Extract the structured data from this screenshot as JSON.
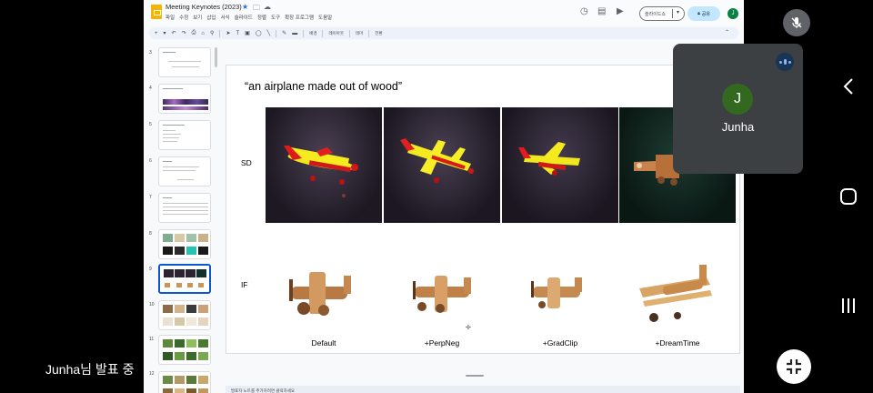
{
  "doc": {
    "title": "Meeting Keynotes (2023)",
    "menu": [
      "파일",
      "수정",
      "보기",
      "삽입",
      "서식",
      "슬라이드",
      "정렬",
      "도구",
      "확장 프로그램",
      "도움말"
    ],
    "slideshow_label": "슬라이드쇼",
    "share_label": "공유",
    "user_initial": "J"
  },
  "toolbar": {
    "background_label": "배경",
    "layout_label": "레이아웃",
    "theme_label": "테마",
    "transition_label": "전환"
  },
  "filmstrip": {
    "slide_numbers": [
      "3",
      "4",
      "5",
      "6",
      "7",
      "8",
      "9",
      "10",
      "11",
      "12"
    ],
    "selected": "9"
  },
  "slide": {
    "title": "“an airplane made out of wood”",
    "row_labels": [
      "SD",
      "IF"
    ],
    "captions": [
      "Default",
      "+PerpNeg",
      "+GradClip",
      "+DreamTime"
    ]
  },
  "notes": {
    "placeholder": "발표자 노트를 추가하려면 클릭하세요"
  },
  "meet": {
    "participant_initial": "J",
    "participant_name": "Junha",
    "presenting_label": "Junha님 발표 중"
  },
  "colors": {
    "accent": "#0b57d0",
    "share_bg": "#c2e7ff",
    "avatar_bg": "#33691e",
    "tile_bg": "#3c4043",
    "doc_icon": "#f4b400"
  }
}
